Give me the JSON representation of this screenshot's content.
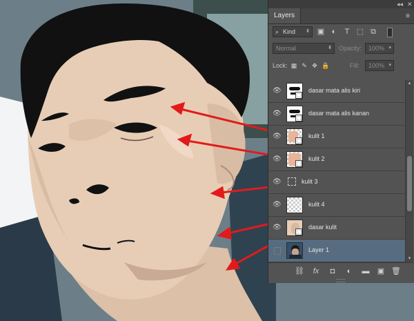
{
  "panel": {
    "collapse_glyph": "◂◂",
    "close_glyph": "✕",
    "tab_label": "Layers",
    "menu_glyph": "≡",
    "filter": {
      "label": "Kind",
      "icon": "search-icon"
    },
    "blend_mode": "Normal",
    "opacity_label": "Opacity:",
    "opacity_value": "100%",
    "lock_label": "Lock:",
    "fill_label": "Fill:",
    "fill_value": "100%"
  },
  "layers": [
    {
      "name": "dasar mata alis kiri",
      "thumb": "brows-left",
      "visible": true,
      "selected": false
    },
    {
      "name": "dasar mata alis kanan",
      "thumb": "brows-right",
      "visible": true,
      "selected": false
    },
    {
      "name": "kulit 1",
      "thumb": "skin",
      "visible": true,
      "selected": false
    },
    {
      "name": "kulit 2",
      "thumb": "skin",
      "visible": true,
      "selected": false
    },
    {
      "name": "kulit 3",
      "thumb": "empty",
      "visible": true,
      "selected": false
    },
    {
      "name": "kulit 4",
      "thumb": "checker",
      "visible": true,
      "selected": false
    },
    {
      "name": "dasar kulit",
      "thumb": "skin-base",
      "visible": true,
      "selected": false
    },
    {
      "name": "Layer 1",
      "thumb": "photo",
      "visible": false,
      "selected": true
    }
  ],
  "bottom_icons": [
    "link-icon",
    "fx-icon",
    "mask-icon",
    "adjustment-icon",
    "folder-icon",
    "new-layer-icon",
    "trash-icon"
  ],
  "bottom_glyphs": [
    "⛓",
    "fx",
    "◘",
    "◐",
    "▬",
    "▣",
    "🗑"
  ],
  "colors": {
    "panel_bg": "#535353",
    "selected_row": "#576c80",
    "skin": "#e8cdb6",
    "skin_shadow": "#d2b39c",
    "hair": "#111111",
    "arrow": "#e11b1b"
  }
}
